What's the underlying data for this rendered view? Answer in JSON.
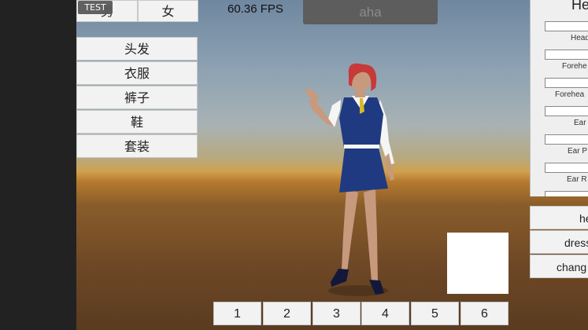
{
  "badge": "TEST",
  "gender": {
    "male": "男",
    "female": "女"
  },
  "menu": [
    "头发",
    "衣服",
    "裤子",
    "鞋",
    "套装"
  ],
  "fps": "60.36 FPS",
  "aha_label": "aha",
  "numbers": [
    "1",
    "2",
    "3",
    "4",
    "5",
    "6"
  ],
  "right_panel": {
    "title": "He",
    "sliders": [
      "Head",
      "Forehe",
      "Forehea",
      "Ear",
      "Ear P",
      "Ear R"
    ]
  },
  "right_buttons": [
    "he",
    "dress",
    "chang"
  ]
}
